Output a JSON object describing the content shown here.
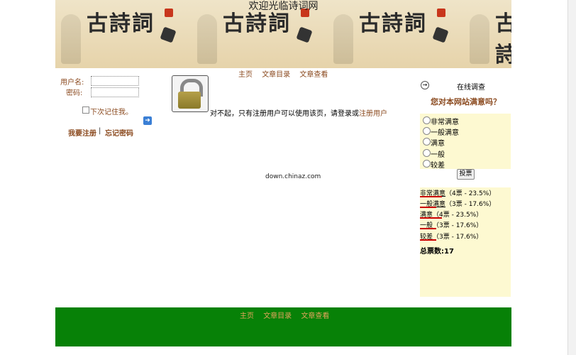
{
  "banner": {
    "title": "欢迎光临诗词网",
    "logo_text": "古詩詞"
  },
  "nav": {
    "home": "主页",
    "catalog": "文章目录",
    "view": "文章查看"
  },
  "login": {
    "username_label": "用户名:",
    "password_label": "密码:",
    "remember_label": "下次记住我。",
    "register_link": "我要注册",
    "separator": "|",
    "forgot_link": "忘记密码"
  },
  "main": {
    "message_prefix": "对不起，只有注册用户可以使用该页，请登录或",
    "message_link": "注册用户",
    "watermark": "down.chinaz.com"
  },
  "survey": {
    "title": "在线调查",
    "question": "您对本网站满意吗？",
    "options": [
      "非常满意",
      "一般满意",
      "满意",
      "一般",
      "较差"
    ],
    "vote_button": "投票",
    "results": [
      {
        "label": "非常满意",
        "detail": "（4票 - 23.5%）",
        "percent": 23.5
      },
      {
        "label": "一般满意",
        "detail": "（3票 - 17.6%）",
        "percent": 17.6
      },
      {
        "label": "满意",
        "detail": "（4票 - 23.5%）",
        "percent": 23.5
      },
      {
        "label": "一般",
        "detail": "（3票 - 17.6%）",
        "percent": 17.6
      },
      {
        "label": "较差",
        "detail": "（3票 - 17.6%）",
        "percent": 17.6
      }
    ],
    "total": "总票数:17"
  },
  "colors": {
    "link": "#8b4a1f",
    "footer": "#078107",
    "panel": "#fdf9d1",
    "bar": "#cc0000"
  }
}
